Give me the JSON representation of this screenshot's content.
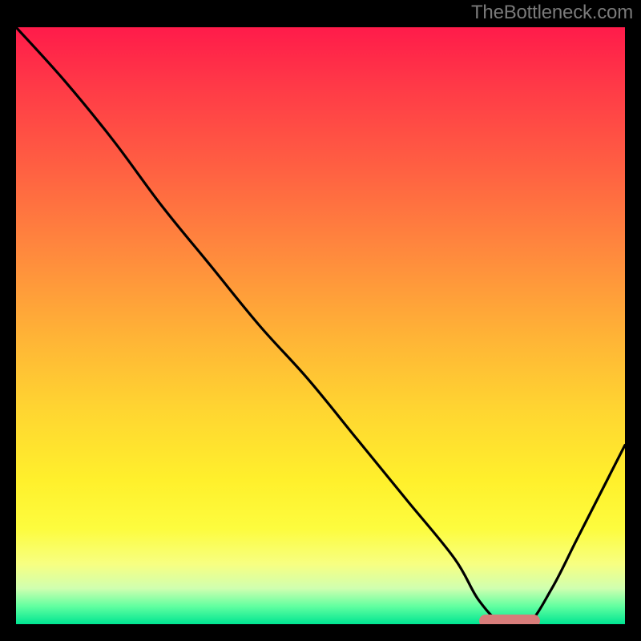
{
  "watermark": "TheBottleneck.com",
  "colors": {
    "background": "#000000",
    "curve": "#000000",
    "marker": "#d87d7a",
    "gradient_top": "#ff1b4a",
    "gradient_bottom": "#00e592",
    "watermark_text": "#7a7a7a"
  },
  "plot": {
    "x_range": [
      0,
      100
    ],
    "y_range": [
      0,
      100
    ]
  },
  "chart_data": {
    "type": "line",
    "title": "",
    "xlabel": "",
    "ylabel": "",
    "xlim": [
      0,
      100
    ],
    "ylim": [
      0,
      100
    ],
    "x": [
      0,
      8,
      16,
      24,
      32,
      40,
      48,
      56,
      64,
      72,
      76,
      80,
      84,
      88,
      92,
      96,
      100
    ],
    "y": [
      100,
      91,
      81,
      70,
      60,
      50,
      41,
      31,
      21,
      11,
      4,
      0,
      0,
      6,
      14,
      22,
      30
    ],
    "marker": {
      "x_start": 76,
      "x_end": 86,
      "y": 0
    }
  }
}
